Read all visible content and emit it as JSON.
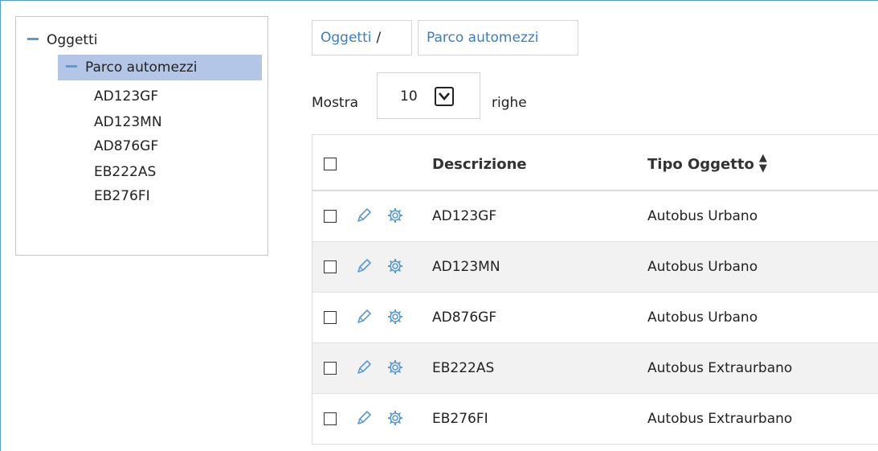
{
  "tree": {
    "root": "Oggetti",
    "selected": "Parco automezzi",
    "leaves": [
      "AD123GF",
      "AD123MN",
      "AD876GF",
      "EB222AS",
      "EB276FI"
    ]
  },
  "breadcrumb": {
    "first": "Oggetti",
    "separator": "/",
    "second": "Parco automezzi"
  },
  "pagination": {
    "show_label": "Mostra",
    "rows_value": "10",
    "rows_label": "righe"
  },
  "table": {
    "columns": [
      "Descrizione",
      "Tipo Oggetto"
    ],
    "rows": [
      {
        "descrizione": "AD123GF",
        "tipo": "Autobus Urbano"
      },
      {
        "descrizione": "AD123MN",
        "tipo": "Autobus Urbano"
      },
      {
        "descrizione": "AD876GF",
        "tipo": "Autobus Urbano"
      },
      {
        "descrizione": "EB222AS",
        "tipo": "Autobus Extraurbano"
      },
      {
        "descrizione": "EB276FI",
        "tipo": "Autobus Extraurbano"
      }
    ]
  },
  "icons": {
    "edit": "pencil-icon",
    "settings": "gear-icon",
    "sort": "sort-icon"
  },
  "colors": {
    "accent": "#5b9bd5",
    "selected_bg": "#b4c6e7",
    "link": "#3a7fc4",
    "row_alt": "#f2f2f2"
  }
}
